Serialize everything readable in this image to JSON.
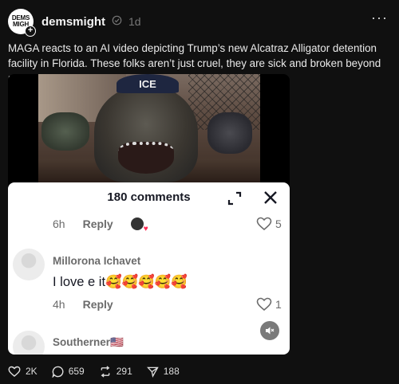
{
  "header": {
    "avatar_text_1": "DEMS",
    "avatar_text_2": "MIGH",
    "username": "demsmight",
    "time": "1d",
    "more": "···"
  },
  "post": {
    "text": "MAGA reacts to an AI video depicting Trump’s new Alcatraz Alligator detention facility in Florida. These folks aren’t just cruel, they are sick and broken beyond repair."
  },
  "video": {
    "cap_text": "ICE"
  },
  "comments_panel": {
    "title": "180 comments",
    "row1": {
      "time": "6h",
      "reply": "Reply",
      "likes": "5"
    },
    "comment": {
      "name": "Millorona Ichavet",
      "text": "I love e it🥰🥰🥰🥰🥰",
      "time": "4h",
      "reply": "Reply",
      "likes": "1"
    },
    "next_comment": {
      "name": "Southerner🇺🇸"
    }
  },
  "actions": {
    "likes": "2K",
    "comments": "659",
    "reposts": "291",
    "shares": "188"
  },
  "colors": {
    "background": "#101010",
    "panel": "#ffffff",
    "accent_heart": "#fe2c55"
  }
}
